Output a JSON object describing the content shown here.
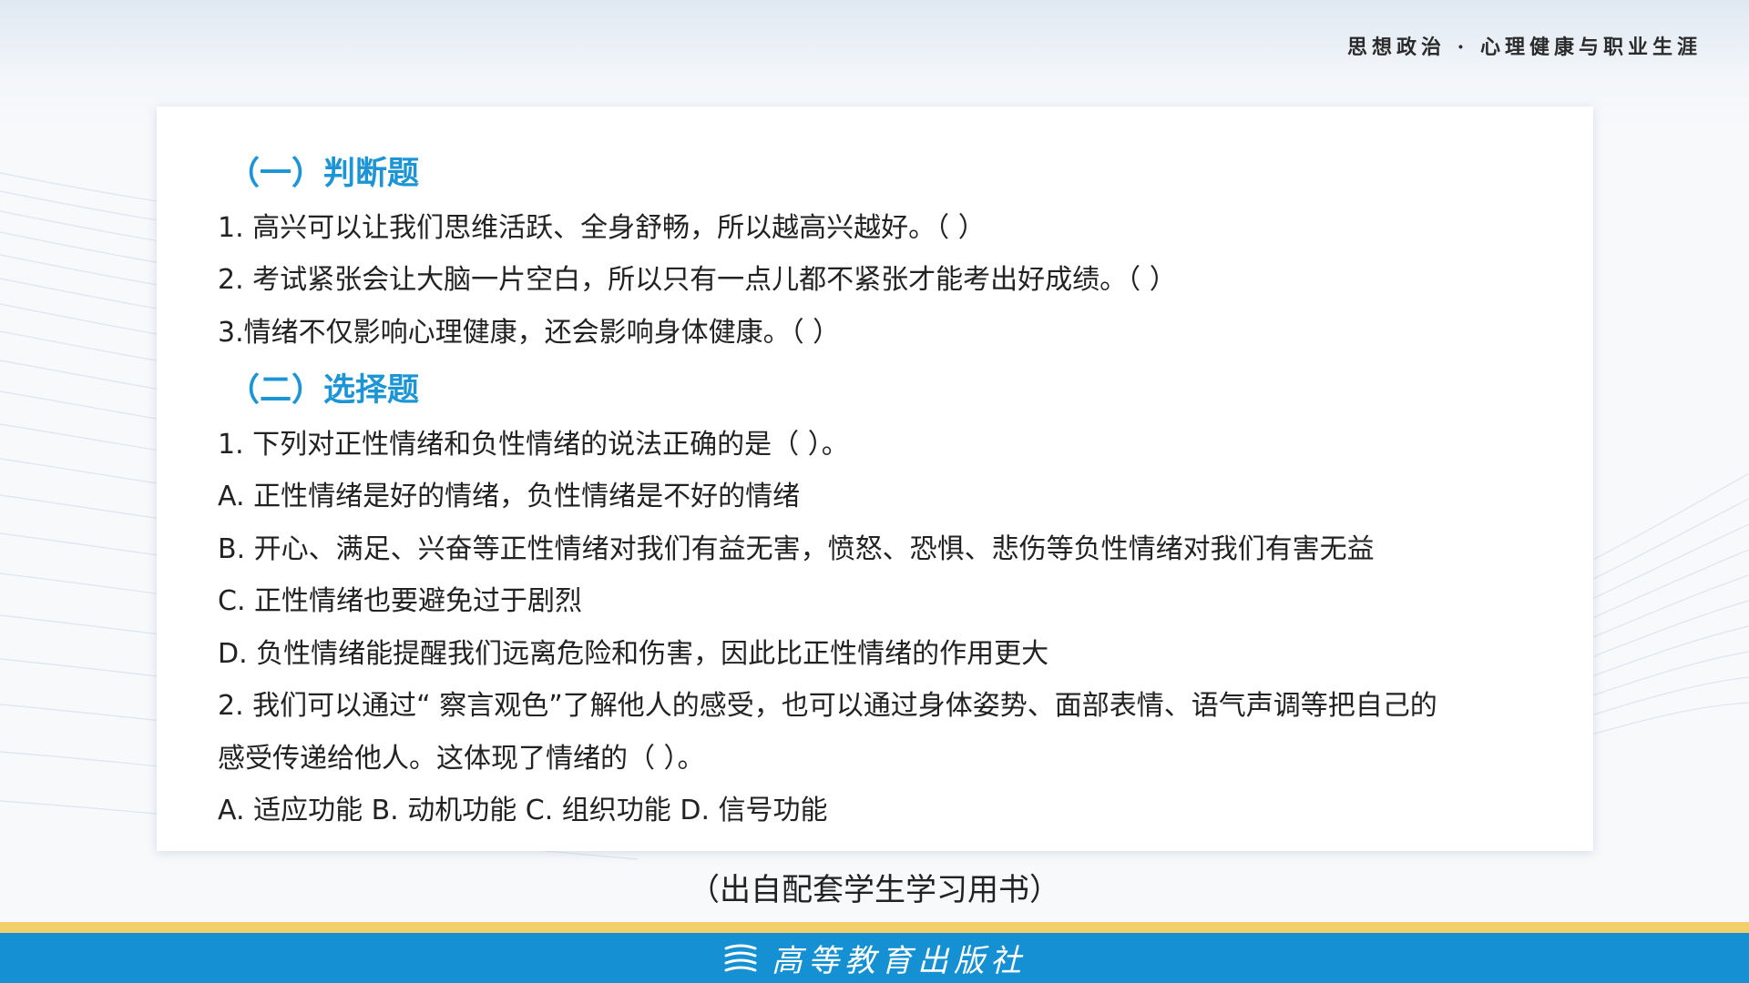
{
  "header": {
    "title": "思想政治 · 心理健康与职业生涯"
  },
  "sections": [
    {
      "heading": "（一）判断题",
      "lines": [
        "1. 高兴可以让我们思维活跃、全身舒畅，所以越高兴越好。（ ）",
        "2. 考试紧张会让大脑一片空白，所以只有一点儿都不紧张才能考出好成绩。（ ）",
        "3.情绪不仅影响心理健康，还会影响身体健康。（ ）"
      ]
    },
    {
      "heading": "（二）选择题",
      "lines": [
        "1. 下列对正性情绪和负性情绪的说法正确的是（ ）。",
        "A. 正性情绪是好的情绪，负性情绪是不好的情绪",
        "B. 开心、满足、兴奋等正性情绪对我们有益无害，愤怒、恐惧、悲伤等负性情绪对我们有害无益",
        "C. 正性情绪也要避免过于剧烈",
        "D. 负性情绪能提醒我们远离危险和伤害，因此比正性情绪的作用更大",
        "2. 我们可以通过“ 察言观色”了解他人的感受，也可以通过身体姿势、面部表情、语气声调等把自己的",
        "感受传递给他人。这体现了情绪的（ ）。",
        "A. 适应功能 B. 动机功能 C. 组织功能 D. 信号功能"
      ]
    }
  ],
  "source_note": "（出自配套学生学习用书）",
  "footer": {
    "publisher_name": "高等教育出版社",
    "logo_icon": "book-stack-icon"
  },
  "colors": {
    "heading_blue": "#1b95d6",
    "footer_blue": "#1590d2",
    "footer_stripe": "#f2cf6a"
  }
}
